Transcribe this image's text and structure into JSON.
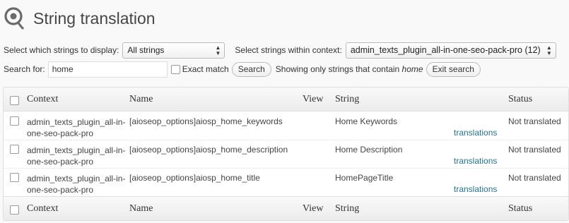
{
  "page": {
    "title": "String translation"
  },
  "filters": {
    "display_label": "Select which strings to display:",
    "display_value": "All strings",
    "context_label": "Select strings within context:",
    "context_value": "admin_texts_plugin_all-in-one-seo-pack-pro (12)"
  },
  "search": {
    "label": "Search for:",
    "value": "home",
    "exact_label": "Exact match",
    "search_button": "Search",
    "showing_prefix": "Showing only strings that contain",
    "showing_term": "home",
    "exit_button": "Exit search"
  },
  "table": {
    "columns": {
      "context": "Context",
      "name": "Name",
      "view": "View",
      "string": "String",
      "status": "Status"
    },
    "rows": [
      {
        "context": "admin_texts_plugin_all-in-one-seo-pack-pro",
        "name": "[aioseop_options]aiosp_home_keywords",
        "string": "Home Keywords",
        "translations": "translations",
        "status": "Not translated"
      },
      {
        "context": "admin_texts_plugin_all-in-one-seo-pack-pro",
        "name": "[aioseop_options]aiosp_home_description",
        "string": "Home Description",
        "translations": "translations",
        "status": "Not translated"
      },
      {
        "context": "admin_texts_plugin_all-in-one-seo-pack-pro",
        "name": "[aioseop_options]aiosp_home_title",
        "string": "HomePageTitle",
        "translations": "translations",
        "status": "Not translated"
      }
    ]
  }
}
